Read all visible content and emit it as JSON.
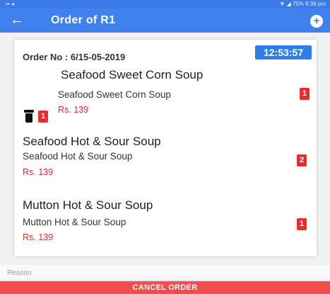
{
  "statusbar": {
    "left": "▪▪ ◂",
    "right": "▼ ◢ 75% 6:36 pm"
  },
  "appbar": {
    "back_icon": "←",
    "title": "Order of R1",
    "add_icon": "+"
  },
  "order": {
    "order_no": "Order No : 6/15-05-2019",
    "timer": "12:53:57"
  },
  "items": [
    {
      "name": "Seafood Sweet Corn Soup",
      "sub": "Seafood Sweet Corn Soup",
      "price": "Rs. 139",
      "left_badge": "1",
      "qty": "1"
    },
    {
      "name": "Seafood Hot & Sour Soup",
      "sub": "Seafood Hot & Sour Soup",
      "price": "Rs. 139",
      "qty": "2"
    },
    {
      "name": "Mutton Hot & Sour Soup",
      "sub": "Mutton Hot & Sour Soup",
      "price": "Rs. 139",
      "qty": "1"
    }
  ],
  "reason": {
    "placeholder": "Reason",
    "value": ""
  },
  "cancel_label": "CANCEL ORDER",
  "colors": {
    "appbar": "#3f82ee",
    "timer": "#2f7de6",
    "accent_red": "#e52f2f",
    "cancel": "#f34c4c"
  }
}
